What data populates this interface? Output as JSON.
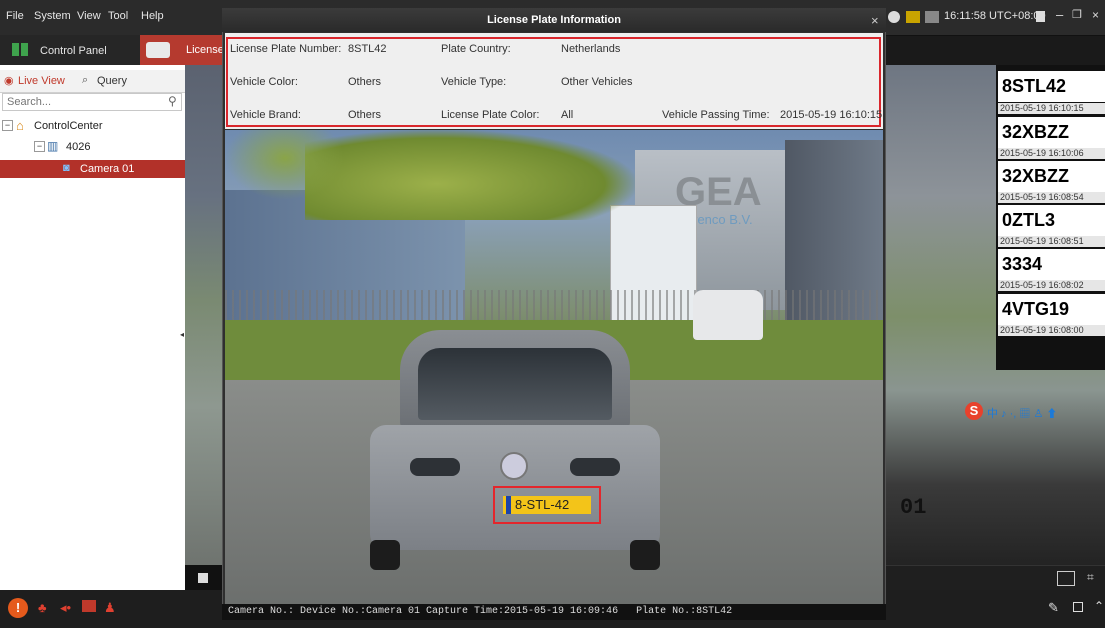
{
  "menu": {
    "items": [
      "File",
      "System",
      "View",
      "Tool",
      "Help"
    ]
  },
  "tabs": {
    "control_panel": "Control Panel",
    "license_tab": "License"
  },
  "left_panel": {
    "tab_live": "Live View",
    "tab_query": "Query",
    "search_placeholder": "Search...",
    "tree": {
      "root": "ControlCenter",
      "node": "4026",
      "camera": "Camera 01"
    }
  },
  "system_tray": {
    "clock": "16:11:58 UTC+08:00"
  },
  "dialog": {
    "title": "License Plate Information",
    "close": "×",
    "fields": {
      "plate_number_label": "License Plate Number:",
      "plate_number_value": "8STL42",
      "plate_country_label": "Plate Country:",
      "plate_country_value": "Netherlands",
      "vehicle_color_label": "Vehicle Color:",
      "vehicle_color_value": "Others",
      "vehicle_type_label": "Vehicle Type:",
      "vehicle_type_value": "Other Vehicles",
      "vehicle_brand_label": "Vehicle Brand:",
      "vehicle_brand_value": "Others",
      "plate_color_label": "License Plate Color:",
      "plate_color_value": "All",
      "passing_time_label": "Vehicle Passing Time:",
      "passing_time_value": "2015-05-19 16:10:15"
    },
    "photo": {
      "building_sign_1": "GEA",
      "building_sign_2": "Grenco B.V.",
      "car_plate": "8-STL-42"
    },
    "caption": "Camera No.: Device No.:Camera 01 Capture Time:2015-05-19 16:09:46   Plate No.:8STL42"
  },
  "plate_list": [
    {
      "plate": "8STL42",
      "time": "2015-05-19 16:10:15"
    },
    {
      "plate": "32XBZZ",
      "time": "2015-05-19 16:10:06"
    },
    {
      "plate": "32XBZZ",
      "time": "2015-05-19 16:08:54"
    },
    {
      "plate": "0ZTL3",
      "time": "2015-05-19 16:08:51"
    },
    {
      "plate": "3334",
      "time": "2015-05-19 16:08:02"
    },
    {
      "plate": "4VTG19",
      "time": "2015-05-19 16:08:00"
    }
  ],
  "video_overlay": {
    "channel": "01"
  },
  "colors": {
    "accent_red": "#d9262c",
    "camera_row": "#b23129"
  }
}
